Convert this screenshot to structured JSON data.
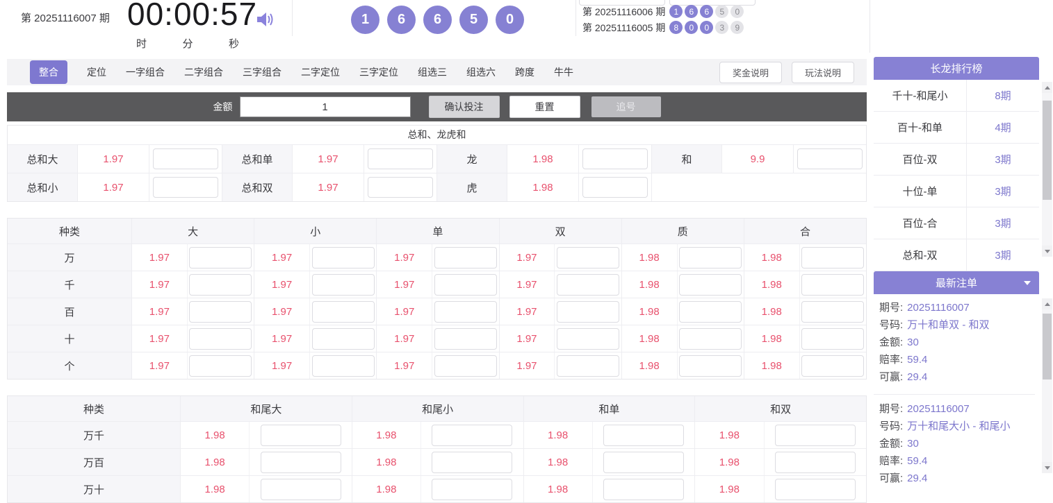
{
  "colors": {
    "accent_purple": "#8681d3",
    "header_purple": "#8781d4",
    "active_tab_purple": "#7e78d0",
    "odds_red": "#e8516d",
    "value_purple": "#7c76cc",
    "betbar_gray": "#59595b"
  },
  "icons": {
    "sound": "speaker-icon",
    "orders_collapse": "caret-down-icon",
    "scroll_up": "scroll-up-arrow-icon",
    "scroll_down": "scroll-down-arrow-icon"
  },
  "header": {
    "period": "第 20251116007 期",
    "timer": "00:00:57",
    "units": [
      "时",
      "分",
      "秒"
    ],
    "balls": [
      "1",
      "6",
      "6",
      "5",
      "0"
    ],
    "history": [
      {
        "period": "第 20251116006 期",
        "balls": [
          "1",
          "6",
          "6",
          "5",
          "0"
        ]
      },
      {
        "period": "第 20251116005 期",
        "balls": [
          "8",
          "0",
          "0",
          "3",
          "9"
        ]
      }
    ]
  },
  "tabs": [
    "整合",
    "定位",
    "一字组合",
    "二字组合",
    "三字组合",
    "二字定位",
    "三字定位",
    "组选三",
    "组选六",
    "跨度",
    "牛牛"
  ],
  "active_tab": "整合",
  "info_buttons": {
    "prize": "奖金说明",
    "play": "玩法说明"
  },
  "betbar": {
    "amount_label": "金额",
    "amount_value": "1",
    "confirm": "确认投注",
    "reset": "重置",
    "chase": "追号"
  },
  "sum_section": {
    "title": "总和、龙虎和",
    "row1": [
      {
        "label": "总和大",
        "odds": "1.97"
      },
      {
        "label": "总和单",
        "odds": "1.97"
      },
      {
        "label": "龙",
        "odds": "1.98"
      },
      {
        "label": "和",
        "odds": "9.9"
      }
    ],
    "row2": [
      {
        "label": "总和小",
        "odds": "1.97"
      },
      {
        "label": "总和双",
        "odds": "1.97"
      },
      {
        "label": "虎",
        "odds": "1.98"
      }
    ]
  },
  "table1": {
    "headers": [
      "种类",
      "大",
      "小",
      "单",
      "双",
      "质",
      "合"
    ],
    "rows": [
      {
        "kind": "万",
        "odds": [
          "1.97",
          "1.97",
          "1.97",
          "1.97",
          "1.98",
          "1.98"
        ]
      },
      {
        "kind": "千",
        "odds": [
          "1.97",
          "1.97",
          "1.97",
          "1.97",
          "1.98",
          "1.98"
        ]
      },
      {
        "kind": "百",
        "odds": [
          "1.97",
          "1.97",
          "1.97",
          "1.97",
          "1.98",
          "1.98"
        ]
      },
      {
        "kind": "十",
        "odds": [
          "1.97",
          "1.97",
          "1.97",
          "1.97",
          "1.98",
          "1.98"
        ]
      },
      {
        "kind": "个",
        "odds": [
          "1.97",
          "1.97",
          "1.97",
          "1.97",
          "1.98",
          "1.98"
        ]
      }
    ]
  },
  "table2": {
    "headers": [
      "种类",
      "和尾大",
      "和尾小",
      "和单",
      "和双"
    ],
    "rows": [
      {
        "kind": "万千",
        "odds": [
          "1.98",
          "1.98",
          "1.98",
          "1.98"
        ]
      },
      {
        "kind": "万百",
        "odds": [
          "1.98",
          "1.98",
          "1.98",
          "1.98"
        ]
      },
      {
        "kind": "万十",
        "odds": [
          "1.98",
          "1.98",
          "1.98",
          "1.98"
        ]
      }
    ]
  },
  "ranking": {
    "title": "长龙排行榜",
    "rows": [
      {
        "name": "千十-和尾小",
        "count": "8期"
      },
      {
        "name": "百十-和单",
        "count": "4期"
      },
      {
        "name": "百位-双",
        "count": "3期"
      },
      {
        "name": "十位-单",
        "count": "3期"
      },
      {
        "name": "百位-合",
        "count": "3期"
      },
      {
        "name": "总和-双",
        "count": "3期"
      }
    ]
  },
  "orders": {
    "title": "最新注单",
    "labels": {
      "period": "期号:",
      "number": "号码:",
      "amount": "金额:",
      "odds": "赔率:",
      "win": "可赢:"
    },
    "entries": [
      {
        "period": "20251116007",
        "number": "万十和单双 - 和双",
        "amount": "30",
        "odds": "59.4",
        "win": "29.4"
      },
      {
        "period": "20251116007",
        "number": "万十和尾大小 - 和尾小",
        "amount": "30",
        "odds": "59.4",
        "win": "29.4"
      }
    ]
  }
}
